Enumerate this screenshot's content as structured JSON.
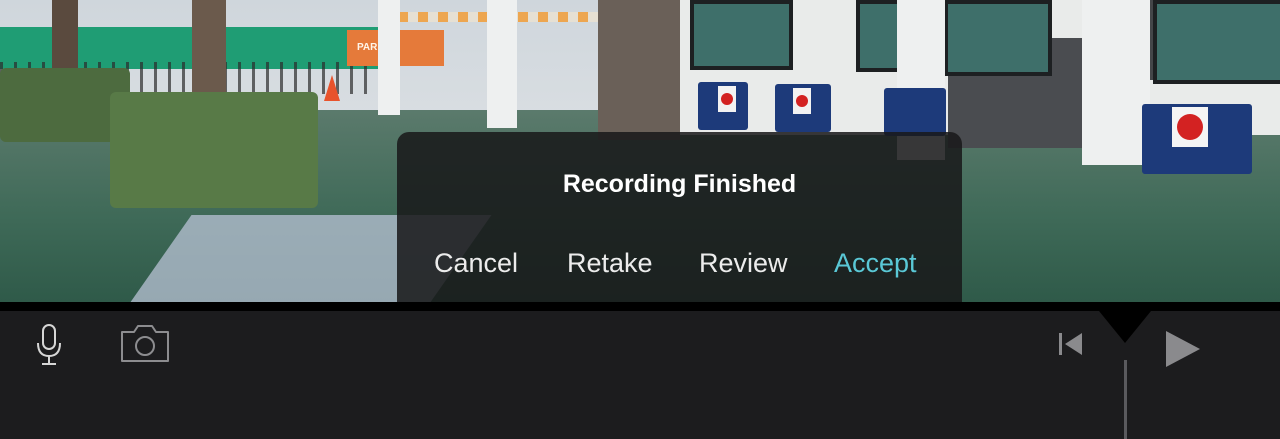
{
  "viewer": {
    "banner_text": "PARKS",
    "accent_sign_color": "#d32222"
  },
  "dialog": {
    "title": "Recording Finished",
    "buttons": {
      "cancel": "Cancel",
      "retake": "Retake",
      "review": "Review",
      "accept": "Accept"
    },
    "accent_color": "#5ac8d6"
  },
  "toolbar": {
    "icons": [
      "microphone-icon",
      "camera-icon",
      "skip-to-start-icon",
      "play-icon"
    ],
    "background_color": "#1c1c1e"
  }
}
